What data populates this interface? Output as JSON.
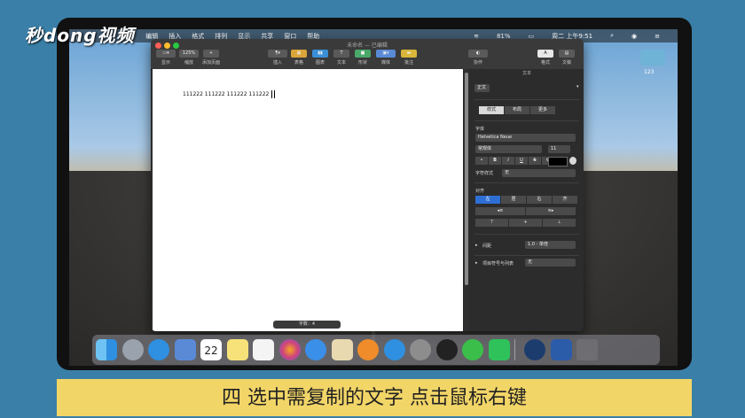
{
  "watermark": "秒dong视频",
  "menubar": {
    "items": [
      "文件",
      "编辑",
      "插入",
      "格式",
      "排列",
      "显示",
      "共享",
      "窗口",
      "帮助"
    ],
    "battery": "81%",
    "datetime": "周二 上午9:51"
  },
  "desktop_icon_label": "123",
  "window": {
    "title": "未命名 — 已编辑",
    "toolbar": [
      {
        "icon": "view-icon",
        "label": "显示"
      },
      {
        "icon": "zoom-dropdown",
        "label": "缩放",
        "value": "125%"
      },
      {
        "icon": "add-page-icon",
        "label": "添加页面"
      },
      {
        "icon": "insert-icon",
        "label": "插入"
      },
      {
        "icon": "table-icon",
        "label": "表格"
      },
      {
        "icon": "chart-icon",
        "label": "图表"
      },
      {
        "icon": "text-icon",
        "label": "文本"
      },
      {
        "icon": "shape-icon",
        "label": "形状"
      },
      {
        "icon": "media-icon",
        "label": "媒体"
      },
      {
        "icon": "comment-icon",
        "label": "批注"
      },
      {
        "icon": "collaborate-icon",
        "label": "协作"
      },
      {
        "icon": "format-icon",
        "label": "格式"
      },
      {
        "icon": "document-icon",
        "label": "文稿"
      }
    ]
  },
  "document": {
    "text": "111222 111222 111222 111222",
    "word_count_label": "字数：4"
  },
  "panel": {
    "header": "文本",
    "paragraph_style": "正文",
    "tabs": [
      "样式",
      "布局",
      "更多"
    ],
    "font_section": "字体",
    "font_name": "Helvetica Neue",
    "font_style": "常规体",
    "font_size": "11",
    "char_styles": [
      "B",
      "I",
      "U",
      "S"
    ],
    "char_style_label": "字符样式",
    "char_style_value": "无",
    "alignment_label": "对齐",
    "align_options": [
      "左",
      "居",
      "右",
      "齐"
    ],
    "spacing_label": "间距",
    "spacing_value": "1.0 - 单倍",
    "bullets_label": "项目符号与列表",
    "bullets_value": "无"
  },
  "dock": [
    "finder-icon",
    "launchpad-icon",
    "safari-icon",
    "photo-icon",
    "calendar-icon",
    "notes-icon",
    "reminders-icon",
    "photos-icon",
    "messages-icon",
    "preview-icon",
    "books-icon",
    "app-store-icon",
    "system-preferences-icon",
    "qq-icon",
    "wechat-icon",
    "iqiyi-icon",
    "quicktime-icon",
    "word-icon",
    "trash-icon"
  ],
  "calendar_day": "22",
  "caption": "四  选中需复制的文字  点击鼠标右键",
  "colors": {
    "accent": "#2e6fd6",
    "caption_bg": "#f2d567"
  }
}
